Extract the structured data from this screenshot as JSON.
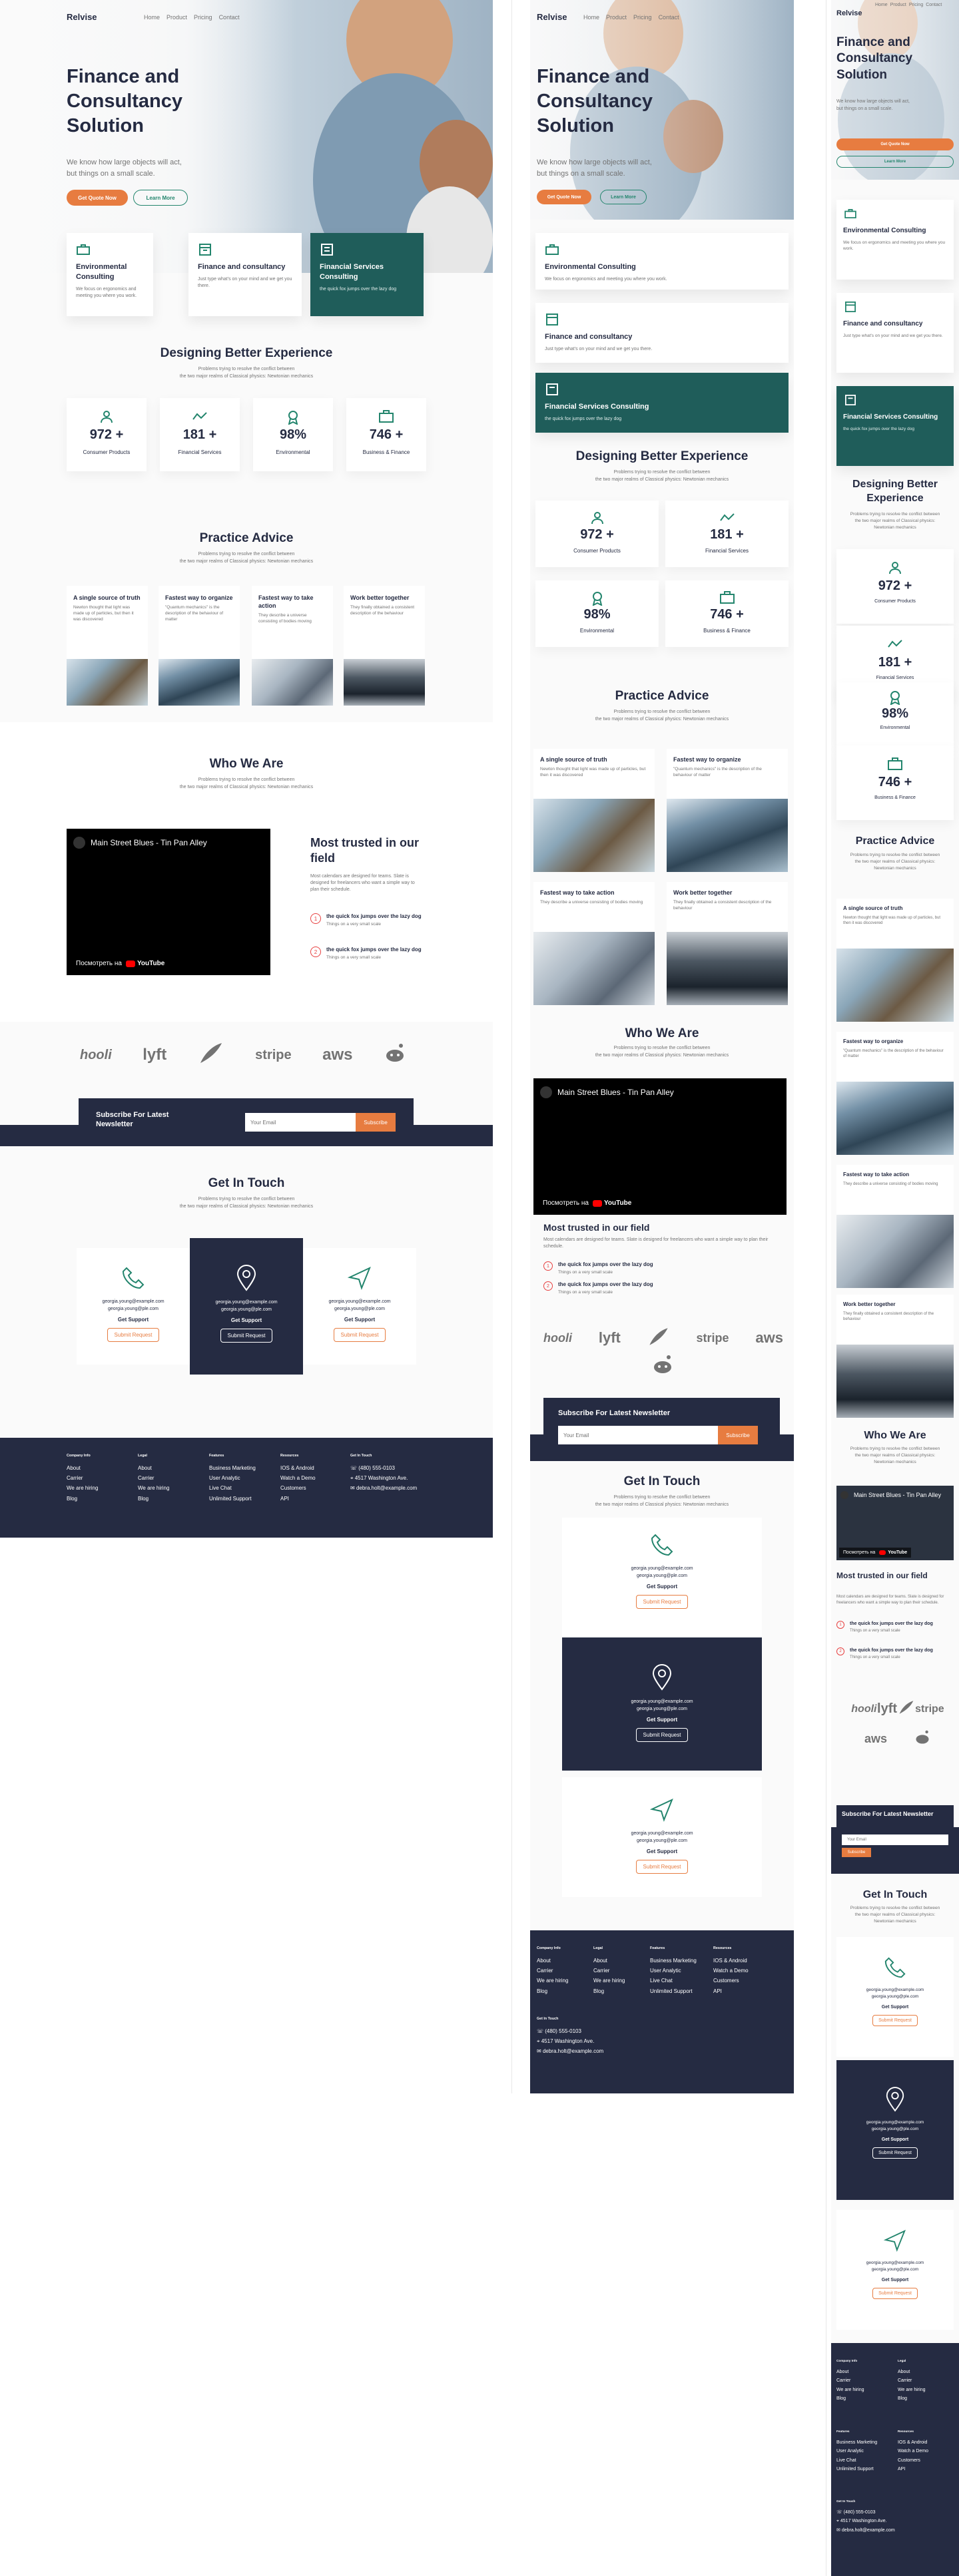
{
  "nav": {
    "logo": "Relvise",
    "links": [
      "Home",
      "Product",
      "Pricing",
      "Contact"
    ]
  },
  "hero": {
    "title_lines": [
      "Finance and",
      "Consultancy",
      "Solution"
    ],
    "subtitle_lines": [
      "We know how large objects will act,",
      "but things on a small scale."
    ],
    "primary_btn": "Get Quote Now",
    "secondary_btn": "Learn More"
  },
  "services": [
    {
      "title": "Environmental Consulting",
      "desc": "We focus on ergonomics and meeting you where you work."
    },
    {
      "title": "Finance and consultancy",
      "desc": "Just type what's on your mind and we get you there."
    },
    {
      "title": "Financial Services Consulting",
      "desc": "the quick fox jumps over the lazy dog"
    }
  ],
  "experience": {
    "title": "Designing Better Experience",
    "subtitle_lines": [
      "Problems trying to resolve the conflict between",
      "the two major realms of Classical physics: Newtonian mechanics"
    ],
    "stats": [
      {
        "value": "972 +",
        "label": "Consumer Products"
      },
      {
        "value": "181 +",
        "label": "Financial Services"
      },
      {
        "value": "98%",
        "label": "Environmental"
      },
      {
        "value": "746 +",
        "label": "Business & Finance"
      }
    ]
  },
  "advice": {
    "title": "Practice Advice",
    "subtitle_lines": [
      "Problems trying to resolve the conflict between",
      "the two major realms of Classical physics: Newtonian mechanics"
    ],
    "cards": [
      {
        "title": "A single source of truth",
        "desc": "Newton thought that light was made up of particles, but then it was discovered"
      },
      {
        "title": "Fastest way to organize",
        "desc": "\"Quantum mechanics\" is the description of the behaviour of matter"
      },
      {
        "title": "Fastest way to take action",
        "desc": "They describe a universe consisting of bodies moving"
      },
      {
        "title": "Work better together",
        "desc": "They finally obtained a consistent description of the behaviour"
      }
    ]
  },
  "who": {
    "title": "Who We Are",
    "subtitle_lines": [
      "Problems trying to resolve the conflict between",
      "the two major realms of Classical physics: Newtonian mechanics"
    ],
    "video_title": "Main Street Blues - Tin Pan Alley",
    "video_watch": "Посмотреть на",
    "video_brand": "YouTube",
    "trusted_title": "Most trusted in our field",
    "trusted_desc": "Most calendars are designed for teams. Slate is designed for freelancers who want a simple way to plan their schedule.",
    "items": [
      {
        "num": "1",
        "title": "the quick fox jumps over the lazy dog",
        "desc": "Things on a very small scale"
      },
      {
        "num": "2",
        "title": "the quick fox jumps over the lazy dog",
        "desc": "Things on a very small scale"
      }
    ]
  },
  "logos": [
    "hooli",
    "lyft",
    "feather",
    "stripe",
    "aws",
    "reddit"
  ],
  "newsletter": {
    "title": "Subscribe For Latest Newsletter",
    "placeholder": "Your Email",
    "button": "Subscribe"
  },
  "contact": {
    "title": "Get In Touch",
    "subtitle_lines": [
      "Problems trying to resolve the conflict between",
      "the two major realms of Classical physics: Newtonian mechanics"
    ],
    "cards": [
      {
        "icon": "phone-icon",
        "email1": "georgia.young@example.com",
        "email2": "georgia.young@ple.com",
        "label": "Get Support",
        "button": "Submit Request"
      },
      {
        "icon": "map-pin-icon",
        "email1": "georgia.young@example.com",
        "email2": "georgia.young@ple.com",
        "label": "Get Support",
        "button": "Submit Request"
      },
      {
        "icon": "send-icon",
        "email1": "georgia.young@example.com",
        "email2": "georgia.young@ple.com",
        "label": "Get Support",
        "button": "Submit Request"
      }
    ]
  },
  "footer": {
    "cols": [
      {
        "title": "Company Info",
        "items": [
          "About",
          "Carrier",
          "We are hiring",
          "Blog"
        ]
      },
      {
        "title": "Legal",
        "items": [
          "About",
          "Carrier",
          "We are hiring",
          "Blog"
        ]
      },
      {
        "title": "Features",
        "items": [
          "Business Marketing",
          "User Analytic",
          "Live Chat",
          "Unlimited Support"
        ]
      },
      {
        "title": "Resources",
        "items": [
          "IOS & Android",
          "Watch a Demo",
          "Customers",
          "API"
        ]
      }
    ],
    "touch_title": "Get In Touch",
    "phone": "(480) 555-0103",
    "address": "4517 Washington Ave.",
    "email": "debra.holt@example.com"
  },
  "colors": {
    "navy": "#252b42",
    "orange": "#e77c40",
    "teal": "#23856d",
    "dark_teal": "#1f5d5a",
    "gray": "#737373"
  }
}
